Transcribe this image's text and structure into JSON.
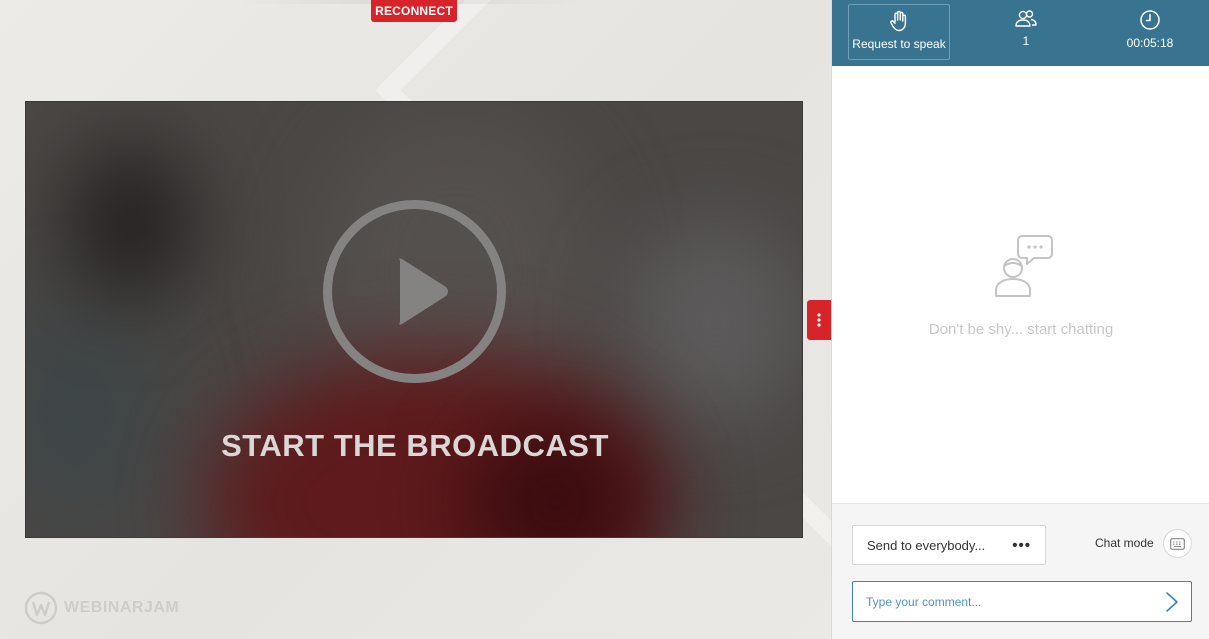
{
  "stage": {
    "reconnect_label": "RECONNECT",
    "broadcast_label": "START THE BROADCAST",
    "logo_text": "WEBINARJAM",
    "play_icon": "play-icon",
    "handle_icon": "more-vertical-icon"
  },
  "header": {
    "request_label": "Request to speak",
    "request_icon": "raised-hand-icon",
    "attendees_count": "1",
    "attendees_icon": "users-icon",
    "timer": "00:05:18",
    "timer_icon": "clock-icon"
  },
  "chat": {
    "empty_icon": "chat-person-icon",
    "empty_text": "Don't be shy... start chatting"
  },
  "footer": {
    "send_to": "Send to everybody...",
    "send_to_more": "•••",
    "chat_mode_label": "Chat mode",
    "chat_mode_icon": "keyboard-icon",
    "comment_placeholder": "Type your comment...",
    "send_icon": "chevron-right-icon"
  },
  "colors": {
    "accent": "#387490",
    "alert": "#d7242b",
    "input_border": "#3a86ad"
  }
}
